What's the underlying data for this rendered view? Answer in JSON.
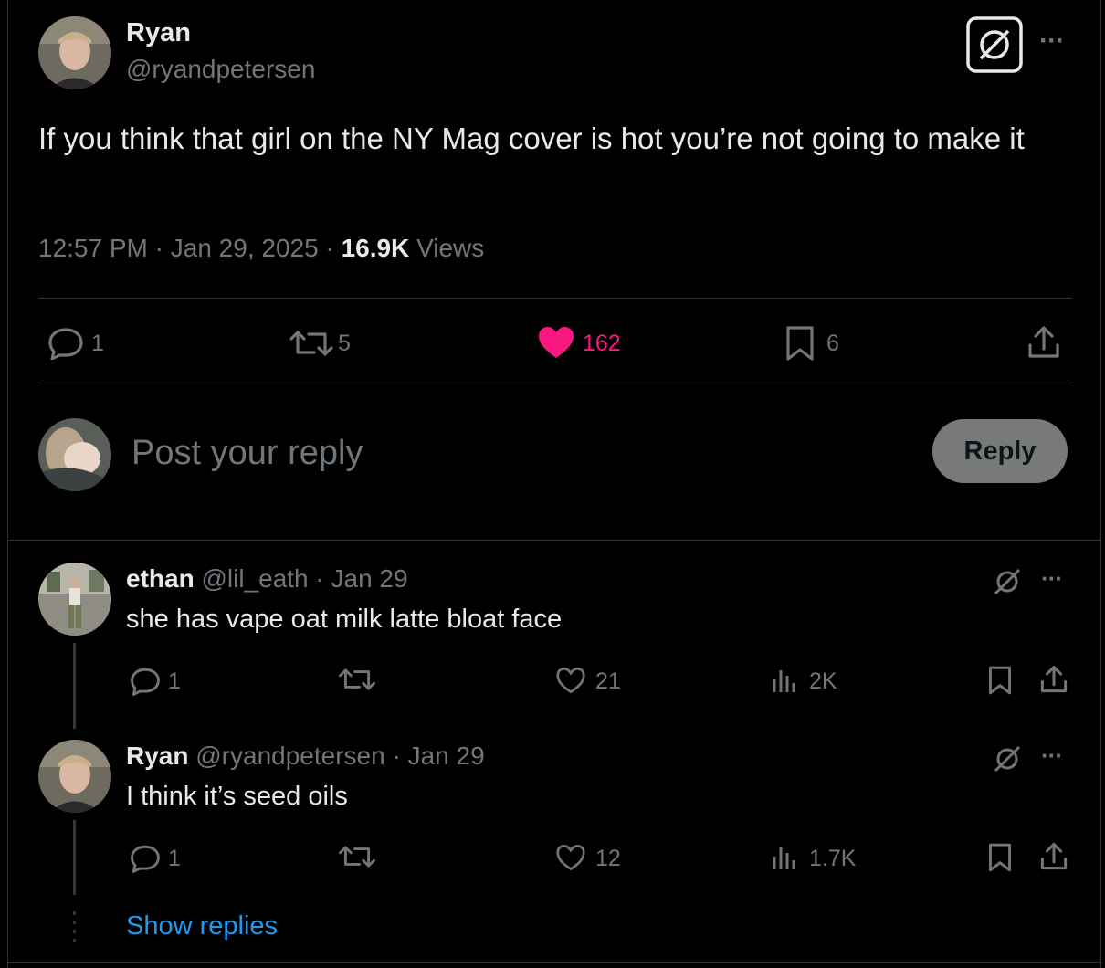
{
  "main_post": {
    "name": "Ryan",
    "handle": "@ryandpetersen",
    "text": "If you think that girl on the NY Mag cover is hot you’re not going to make it",
    "time": "12:57 PM",
    "date": "Jan 29, 2025",
    "sep": "·",
    "views_count": "16.9K",
    "views_label": "Views",
    "actions": {
      "replies": "1",
      "reposts": "5",
      "likes": "162",
      "bookmarks": "6"
    }
  },
  "reply_box": {
    "placeholder": "Post your reply",
    "button": "Reply"
  },
  "replies": [
    {
      "name": "ethan",
      "handle": "@lil_eath",
      "date": "· Jan 29",
      "text": "she has vape oat milk latte bloat face",
      "replies": "1",
      "likes": "21",
      "views": "2K"
    },
    {
      "name": "Ryan",
      "handle": "@ryandpetersen",
      "date": "· Jan 29",
      "text": "I think it’s seed oils",
      "replies": "1",
      "likes": "12",
      "views": "1.7K"
    }
  ],
  "show_replies": "Show replies",
  "colors": {
    "background": "#000000",
    "text": "#e7e9ea",
    "muted": "#71767b",
    "like": "#f91880",
    "link": "#1d9bf0",
    "divider": "#2f3336"
  },
  "icons": {
    "grok": "grok-icon",
    "more": "more-icon",
    "reply": "reply-icon",
    "repost": "repost-icon",
    "like": "heart-icon",
    "bookmark": "bookmark-icon",
    "share": "share-icon",
    "views": "analytics-icon"
  }
}
